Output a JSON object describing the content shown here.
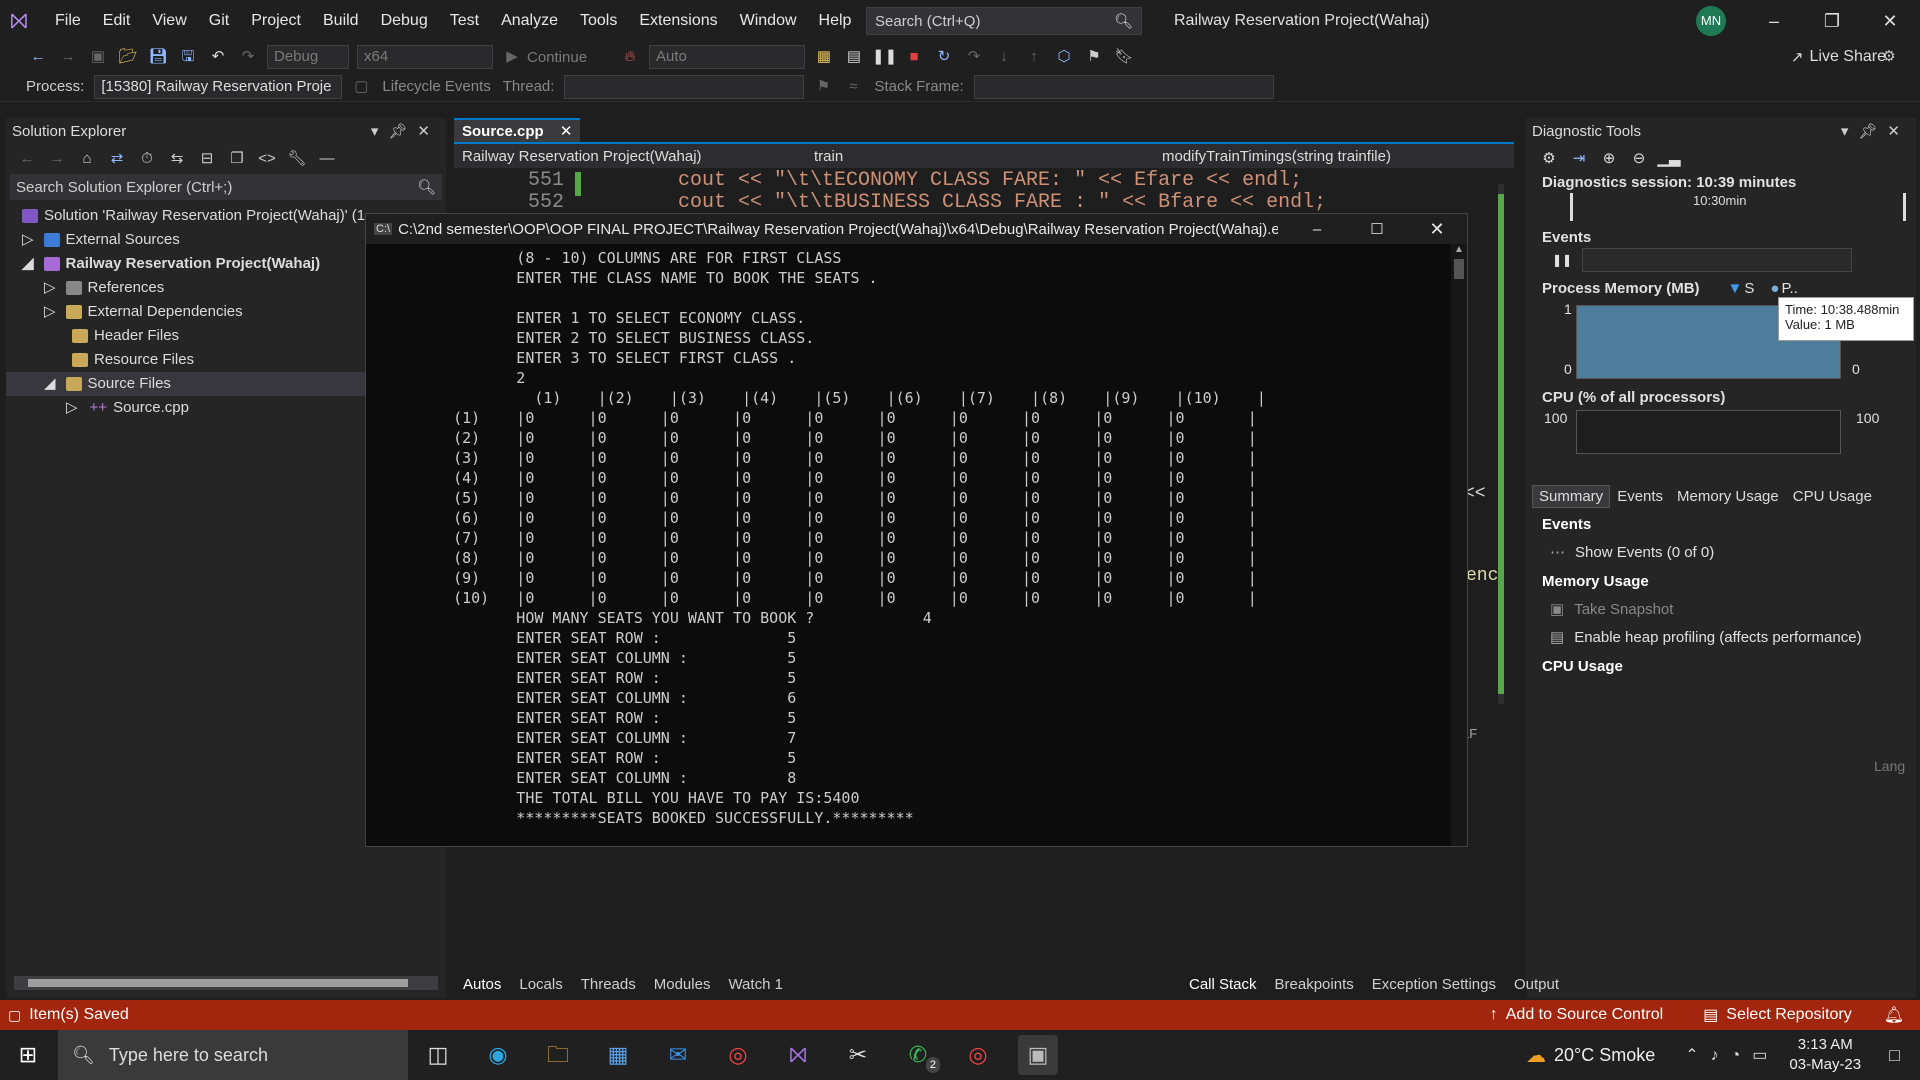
{
  "titlebar": {
    "menus": [
      "File",
      "Edit",
      "View",
      "Git",
      "Project",
      "Build",
      "Debug",
      "Test",
      "Analyze",
      "Tools",
      "Extensions",
      "Window",
      "Help"
    ],
    "search": "Search (Ctrl+Q)",
    "title": "Railway Reservation Project(Wahaj)",
    "avatar": "MN"
  },
  "toolbar": {
    "config": "Debug",
    "platform": "x64",
    "continue": "Continue",
    "auto": "Auto",
    "live_share": "Live Share",
    "process_label": "Process:",
    "process": "[15380] Railway Reservation Proje",
    "lifecycle": "Lifecycle Events",
    "thread": "Thread:",
    "stack_frame": "Stack Frame:"
  },
  "solution_explorer": {
    "title": "Solution Explorer",
    "search": "Search Solution Explorer (Ctrl+;)",
    "items": [
      {
        "label": "Solution 'Railway Reservation Project(Wahaj)' (1"
      },
      {
        "label": "External Sources"
      },
      {
        "label": "Railway Reservation Project(Wahaj)"
      },
      {
        "label": "References"
      },
      {
        "label": "External Dependencies"
      },
      {
        "label": "Header Files"
      },
      {
        "label": "Resource Files"
      },
      {
        "label": "Source Files"
      },
      {
        "label": "Source.cpp"
      }
    ]
  },
  "editor": {
    "tab": "Source.cpp",
    "nav_project": "Railway Reservation Project(Wahaj)",
    "nav_scope": "train",
    "nav_func": "modifyTrainTimings(string trainfile)",
    "line1_no": "551",
    "line1": "cout << \"\\t\\tECONOMY CLASS FARE: \" << Efare << endl;",
    "line2_no": "552",
    "line2": "cout << \"\\t\\tBUSINESS CLASS FARE : \" << Bfare << endl;",
    "frag1": "<<",
    "frag2": "enc",
    "lf": "LF"
  },
  "console": {
    "title": "C:\\2nd semester\\OOP\\OOP FINAL PROJECT\\Railway Reservation Project(Wahaj)\\x64\\Debug\\Railway Reservation Project(Wahaj).exe",
    "lines": [
      "          (8 - 10) COLUMNS ARE FOR FIRST CLASS",
      "          ENTER THE CLASS NAME TO BOOK THE SEATS .",
      "",
      "          ENTER 1 TO SELECT ECONOMY CLASS.",
      "          ENTER 2 TO SELECT BUSINESS CLASS.",
      "          ENTER 3 TO SELECT FIRST CLASS .",
      "          2",
      "            (1)    |(2)    |(3)    |(4)    |(5)    |(6)    |(7)    |(8)    |(9)    |(10)    |",
      "   (1)    |0      |0      |0      |0      |0      |0      |0      |0      |0      |0       |",
      "   (2)    |0      |0      |0      |0      |0      |0      |0      |0      |0      |0       |",
      "   (3)    |0      |0      |0      |0      |0      |0      |0      |0      |0      |0       |",
      "   (4)    |0      |0      |0      |0      |0      |0      |0      |0      |0      |0       |",
      "   (5)    |0      |0      |0      |0      |0      |0      |0      |0      |0      |0       |",
      "   (6)    |0      |0      |0      |0      |0      |0      |0      |0      |0      |0       |",
      "   (7)    |0      |0      |0      |0      |0      |0      |0      |0      |0      |0       |",
      "   (8)    |0      |0      |0      |0      |0      |0      |0      |0      |0      |0       |",
      "   (9)    |0      |0      |0      |0      |0      |0      |0      |0      |0      |0       |",
      "   (10)   |0      |0      |0      |0      |0      |0      |0      |0      |0      |0       |",
      "          HOW MANY SEATS YOU WANT TO BOOK ?            4",
      "          ENTER SEAT ROW :              5",
      "          ENTER SEAT COLUMN :           5",
      "          ENTER SEAT ROW :              5",
      "          ENTER SEAT COLUMN :           6",
      "          ENTER SEAT ROW :              5",
      "          ENTER SEAT COLUMN :           7",
      "          ENTER SEAT ROW :              5",
      "          ENTER SEAT COLUMN :           8",
      "          THE TOTAL BILL YOU HAVE TO PAY IS:5400",
      "          *********SEATS BOOKED SUCCESSFULLY.*********"
    ]
  },
  "diagnostics": {
    "title": "Diagnostic Tools",
    "session": "Diagnostics session: 10:39 minutes",
    "timeline": "10:30min",
    "events": "Events",
    "memory": "Process Memory (MB)",
    "legend_s": "S",
    "legend_p": "P..",
    "mem_max": "1",
    "mem_min": "0",
    "mem_max_r": "0",
    "tooltip_time": "Time: 10:38.488min",
    "tooltip_value": "Value: 1 MB",
    "cpu": "CPU (% of all processors)",
    "cpu_max": "100",
    "cpu_max_r": "100",
    "tabs": [
      "Summary",
      "Events",
      "Memory Usage",
      "CPU Usage"
    ],
    "sec_events": "Events",
    "show_events": "Show Events (0 of 0)",
    "sec_memory": "Memory Usage",
    "snapshot": "Take Snapshot",
    "heap": "Enable heap profiling (affects performance)",
    "sec_cpu": "CPU Usage",
    "lang": "Lang"
  },
  "bottom": {
    "left_tabs": [
      "Autos",
      "Locals",
      "Threads",
      "Modules",
      "Watch 1"
    ],
    "right_tabs": [
      "Call Stack",
      "Breakpoints",
      "Exception Settings",
      "Output"
    ]
  },
  "status": {
    "text": "Item(s) Saved",
    "source_control": "Add to Source Control",
    "repo": "Select Repository"
  },
  "taskbar": {
    "search": "Type here to search",
    "weather": "20°C Smoke",
    "time": "3:13 AM",
    "date": "03-May-23",
    "badge": "2"
  },
  "colors": {
    "status": "#a1260d",
    "accent": "#007acc"
  }
}
